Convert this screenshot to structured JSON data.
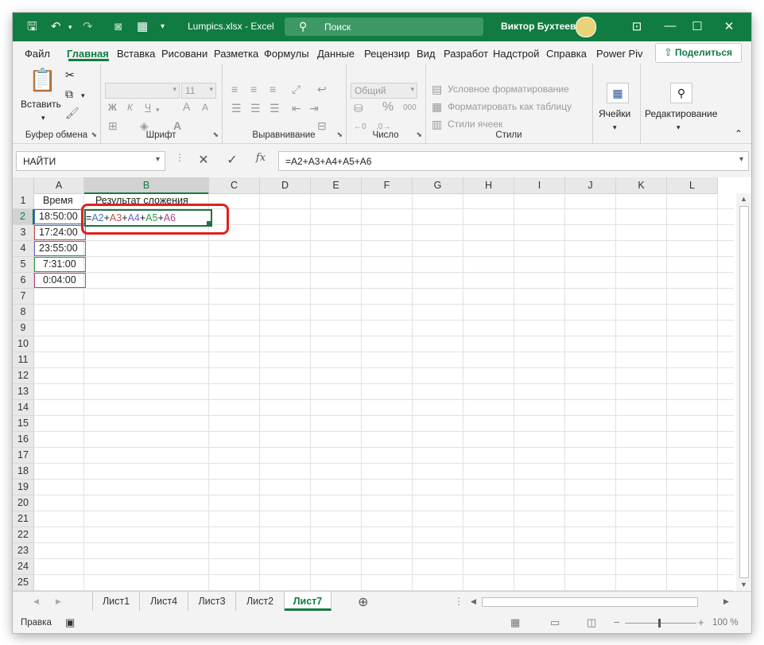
{
  "titlebar": {
    "filename": "Lumpics.xlsx",
    "separator": "-",
    "app": "Excel",
    "search_placeholder": "Поиск",
    "user_name": "Виктор Бухтеев"
  },
  "menu": {
    "tabs": [
      "Файл",
      "Главная",
      "Вставка",
      "Рисовани",
      "Разметка",
      "Формулы",
      "Данные",
      "Рецензир",
      "Вид",
      "Разработ",
      "Надстрой",
      "Справка",
      "Power Piv"
    ],
    "active_tab": "Главная",
    "share_label": "Поделиться"
  },
  "ribbon": {
    "clipboard": {
      "paste_label": "Вставить",
      "group_label": "Буфер обмена"
    },
    "font": {
      "font_name": "",
      "font_size": "11",
      "bold": "Ж",
      "italic": "К",
      "underline": "Ч",
      "grow": "A",
      "shrink": "A",
      "group_label": "Шрифт"
    },
    "alignment": {
      "group_label": "Выравнивание"
    },
    "number": {
      "format": "Общий",
      "percent": "%",
      "thousands": "000",
      "group_label": "Число"
    },
    "styles": {
      "conditional": "Условное форматирование",
      "format_table": "Форматировать как таблицу",
      "cell_styles": "Стили ячеек",
      "group_label": "Стили"
    },
    "cells": {
      "label": "Ячейки"
    },
    "editing": {
      "label": "Редактирование"
    }
  },
  "formula_bar": {
    "name_box": "НАЙТИ",
    "fx": "fx",
    "formula": "=A2+A3+A4+A5+A6"
  },
  "grid": {
    "columns": [
      "A",
      "B",
      "C",
      "D",
      "E",
      "F",
      "G",
      "H",
      "I",
      "J",
      "K",
      "L"
    ],
    "rows": [
      "1",
      "2",
      "3",
      "4",
      "5",
      "6",
      "7",
      "8",
      "9",
      "10",
      "11",
      "12",
      "13",
      "14",
      "15",
      "16",
      "17",
      "18",
      "19",
      "20",
      "21",
      "22",
      "23",
      "24",
      "25"
    ],
    "cells": {
      "A1": "Время",
      "B1": "Результат сложения",
      "A2": "18:50:00",
      "A3": "17:24:00",
      "A4": "23:55:00",
      "A5": "7:31:00",
      "A6": "0:04:00"
    },
    "formula_parts": [
      "=",
      "A2",
      "+",
      "A3",
      "+",
      "A4",
      "+",
      "A5",
      "+",
      "A6"
    ],
    "ref_colors": [
      "#4472c4",
      "#c0504d",
      "#7b5cc7",
      "#2e9c3c",
      "#b4418e"
    ]
  },
  "sheets": {
    "tabs": [
      "Лист1",
      "Лист4",
      "Лист3",
      "Лист2",
      "Лист7"
    ],
    "active": "Лист7"
  },
  "statusbar": {
    "mode": "Правка",
    "zoom": "100 %",
    "zoom_minus": "−",
    "zoom_plus": "+"
  }
}
